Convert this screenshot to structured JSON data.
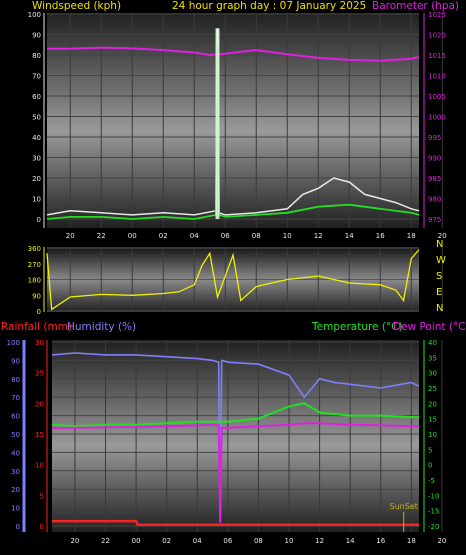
{
  "header": {
    "left_label": "Windspeed (kph)",
    "center_title": "24 hour graph day : 07 January 2025",
    "right_label": "Barometer (hpa)"
  },
  "colors": {
    "background": "#000000",
    "wind_speed": "#e8e8e8",
    "wind_avg": "#22dd22",
    "barometer": "#e020e0",
    "wind_dir": "#f0f000",
    "temperature": "#22e022",
    "dew_point": "#e020e0",
    "humidity": "#7f7fff",
    "rainfall": "#ff2020",
    "label_yellow": "#f0e000",
    "label_green": "#22e022",
    "label_magenta": "#e020e0",
    "label_blue": "#7f7fff",
    "label_red": "#ff2020"
  },
  "x_ticks": [
    "20",
    "22",
    "00",
    "02",
    "04",
    "06",
    "08",
    "10",
    "12",
    "14",
    "16",
    "18",
    "20",
    "22",
    "00"
  ],
  "chart_data": [
    {
      "type": "line",
      "name": "wind-barometer",
      "x_range_hours": [
        18.5,
        42.5
      ],
      "y_left_ticks": [
        "0",
        "10",
        "20",
        "30",
        "40",
        "50",
        "60",
        "70",
        "80",
        "90",
        "100"
      ],
      "y_left_range": [
        0,
        100
      ],
      "y_right_ticks": [
        "975",
        "980",
        "985",
        "990",
        "995",
        "1000",
        "1005",
        "1010",
        "1015",
        "1020",
        "1025"
      ],
      "y_right_range": [
        975,
        1025
      ],
      "series": [
        {
          "name": "Barometer",
          "axis": "right",
          "x": [
            18.5,
            20,
            22,
            24,
            26,
            28,
            29,
            30,
            31,
            32,
            34,
            36,
            38,
            40,
            42,
            42.5
          ],
          "values": [
            1016.5,
            1016.5,
            1016.8,
            1016.6,
            1016.2,
            1015.6,
            1015,
            1015.3,
            1015.8,
            1016.2,
            1015.2,
            1014.3,
            1013.8,
            1013.6,
            1014.1,
            1014.5
          ]
        },
        {
          "name": "Windspeed",
          "axis": "left",
          "x": [
            18.5,
            20,
            22,
            24,
            26,
            28,
            29.4,
            29.5,
            29.6,
            30,
            32,
            34,
            35,
            36,
            37,
            38,
            39,
            40,
            41,
            42,
            42.5
          ],
          "values": [
            2,
            4,
            3,
            2,
            3,
            2,
            4,
            93,
            3,
            2,
            3,
            5,
            12,
            15,
            20,
            18,
            12,
            10,
            8,
            5,
            4
          ]
        },
        {
          "name": "Wind average",
          "axis": "left",
          "x": [
            18.5,
            20,
            22,
            24,
            26,
            28,
            29.4,
            29.5,
            29.6,
            30,
            32,
            34,
            36,
            38,
            40,
            42,
            42.5
          ],
          "values": [
            0,
            1,
            1,
            0,
            1,
            0,
            2,
            85,
            2,
            1,
            2,
            3,
            6,
            7,
            5,
            3,
            2
          ]
        }
      ]
    },
    {
      "type": "scatter",
      "name": "wind-direction",
      "x_range_hours": [
        18.5,
        42.5
      ],
      "y_ticks": [
        "0",
        "90",
        "180",
        "270",
        "360"
      ],
      "y_range": [
        0,
        360
      ],
      "y_right_ticks": [
        "N",
        "W",
        "S",
        "E",
        "N"
      ],
      "series": [
        {
          "name": "Wind direction",
          "x": [
            18.5,
            18.8,
            20,
            22,
            24,
            26,
            27,
            28,
            28.5,
            29,
            29.5,
            30,
            30.5,
            31,
            32,
            34,
            36,
            38,
            40,
            41,
            41.5,
            42,
            42.5
          ],
          "values": [
            330,
            10,
            80,
            95,
            90,
            100,
            110,
            150,
            260,
            330,
            80,
            200,
            320,
            60,
            140,
            180,
            200,
            160,
            150,
            120,
            60,
            300,
            350
          ]
        }
      ]
    },
    {
      "type": "line",
      "name": "temperature-humidity-rain",
      "x_range_hours": [
        18.5,
        42.5
      ],
      "y_left_ticks": [
        "0",
        "10",
        "20",
        "30",
        "40",
        "50",
        "60",
        "70",
        "80",
        "90",
        "100"
      ],
      "y_left_range": [
        0,
        100
      ],
      "y_rain_ticks": [
        "0",
        "5",
        "10",
        "15",
        "20",
        "25",
        "30"
      ],
      "y_rain_range": [
        0,
        30
      ],
      "y_right_ticks": [
        "-20",
        "-15",
        "-10",
        "-5",
        "0",
        "5",
        "10",
        "15",
        "20",
        "25",
        "30",
        "35",
        "40"
      ],
      "y_right_range": [
        -20,
        40
      ],
      "labels": {
        "rainfall": "Rainfall (mm)",
        "humidity": "Humidity (%)",
        "temperature": "Temperature (°C)",
        "dew_point": "Dew Point (°C)",
        "sunset": "SunSet"
      },
      "sunset_hour": 41.5,
      "series": [
        {
          "name": "Humidity",
          "axis": "left",
          "x": [
            18.5,
            20,
            22,
            24,
            26,
            28,
            29,
            29.4,
            29.5,
            29.6,
            30,
            32,
            34,
            35,
            36,
            37,
            38,
            40,
            42,
            42.5
          ],
          "values": [
            93,
            94,
            93,
            93,
            92,
            91,
            90,
            89,
            2,
            90,
            89,
            88,
            82,
            70,
            80,
            78,
            77,
            75,
            78,
            76
          ]
        },
        {
          "name": "Temperature",
          "axis": "right",
          "x": [
            18.5,
            20,
            22,
            24,
            26,
            28,
            30,
            32,
            33,
            34,
            35,
            36,
            38,
            40,
            42,
            42.5
          ],
          "values": [
            13,
            12.5,
            13,
            13,
            13.5,
            14,
            14,
            15,
            17,
            19,
            20,
            17,
            16,
            16,
            15.5,
            15.5
          ]
        },
        {
          "name": "Dew Point",
          "axis": "right",
          "x": [
            18.5,
            20,
            22,
            24,
            26,
            28,
            29.4,
            29.5,
            29.6,
            30,
            32,
            34,
            35,
            36,
            38,
            40,
            42,
            42.5
          ],
          "values": [
            12,
            12,
            12.2,
            12.3,
            12.5,
            12.8,
            13,
            -19,
            12,
            12,
            12.5,
            13,
            13.5,
            13.5,
            13,
            12.8,
            12.5,
            12.5
          ]
        },
        {
          "name": "Rainfall",
          "axis": "rain",
          "x": [
            18.5,
            24,
            24.1,
            42.5
          ],
          "values": [
            0.8,
            0.8,
            0.2,
            0.2
          ]
        }
      ]
    }
  ]
}
